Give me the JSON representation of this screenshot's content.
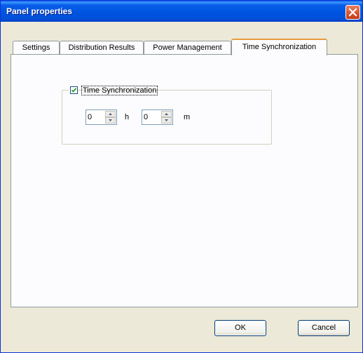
{
  "window": {
    "title": "Panel properties"
  },
  "tabs": [
    {
      "label": "Settings",
      "active": false
    },
    {
      "label": "Distribution Results",
      "active": false
    },
    {
      "label": "Power Management",
      "active": false
    },
    {
      "label": "Time Synchronization",
      "active": true
    }
  ],
  "time_sync": {
    "enabled": true,
    "checkbox_label": "Time Synchronization",
    "hours_value": "0",
    "hours_unit": "h",
    "minutes_value": "0",
    "minutes_unit": "m"
  },
  "footer": {
    "ok_label": "OK",
    "cancel_label": "Cancel"
  },
  "icons": {
    "close": "close-icon",
    "check": "check-icon",
    "spin_up": "arrow-up-icon",
    "spin_down": "arrow-down-icon"
  },
  "colors": {
    "titlebar": "#0055e3",
    "active_tab_accent": "#e69c3c",
    "close_button": "#d4532f"
  }
}
